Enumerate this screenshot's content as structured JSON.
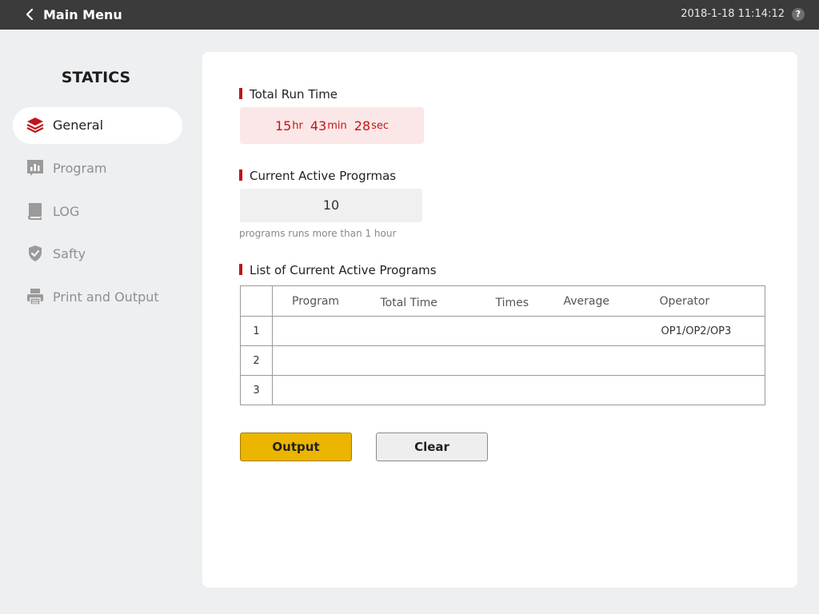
{
  "header": {
    "title": "Main Menu",
    "datetime": "2018-1-18 11:14:12",
    "help_label": "?"
  },
  "sidebar": {
    "title": "STATICS",
    "items": [
      {
        "label": "General",
        "icon": "layers-icon",
        "active": true
      },
      {
        "label": "Program",
        "icon": "bar-chart-icon",
        "active": false
      },
      {
        "label": "LOG",
        "icon": "book-icon",
        "active": false
      },
      {
        "label": "Safty",
        "icon": "shield-icon",
        "active": false
      },
      {
        "label": "Print and Output",
        "icon": "printer-icon",
        "active": false
      }
    ]
  },
  "main": {
    "total_run_time": {
      "title": "Total Run Time",
      "hours": "15",
      "hours_unit": "hr",
      "minutes": "43",
      "minutes_unit": "min",
      "seconds": "28",
      "seconds_unit": "sec"
    },
    "current_active": {
      "title": "Current Active Progrmas",
      "value": "10",
      "note": "programs runs more than 1 hour"
    },
    "list": {
      "title": "List of Current Active Programs",
      "columns": [
        "",
        "Program",
        "Total Time",
        "Times",
        "Average",
        "Operator"
      ],
      "rows": [
        {
          "num": "1",
          "program": "",
          "total_time": "",
          "times": "",
          "average": "",
          "operator": "OP1/OP2/OP3"
        },
        {
          "num": "2",
          "program": "",
          "total_time": "",
          "times": "",
          "average": "",
          "operator": ""
        },
        {
          "num": "3",
          "program": "",
          "total_time": "",
          "times": "",
          "average": "",
          "operator": ""
        }
      ]
    },
    "buttons": {
      "output_label": "Output",
      "clear_label": "Clear"
    }
  },
  "colors": {
    "accent_red": "#c0151b",
    "output_yellow": "#ecb500",
    "topbar": "#3b3b3b"
  }
}
